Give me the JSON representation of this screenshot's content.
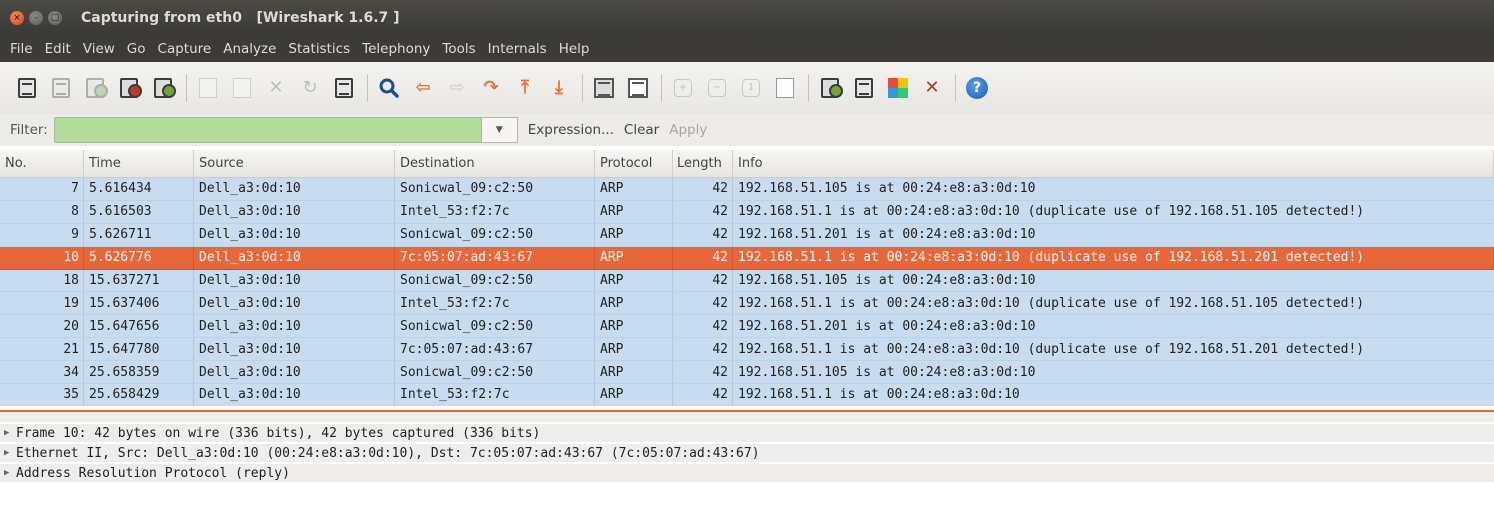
{
  "window": {
    "title": "Capturing from eth0   [Wireshark 1.6.7 ]",
    "close_glyph": "×",
    "min_glyph": "–",
    "max_glyph": "□"
  },
  "menu": [
    "File",
    "Edit",
    "View",
    "Go",
    "Capture",
    "Analyze",
    "Statistics",
    "Telephony",
    "Tools",
    "Internals",
    "Help"
  ],
  "toolbar": {
    "icons": [
      "interfaces-icon",
      "capture-options-icon",
      "start-capture-icon",
      "stop-capture-icon",
      "restart-capture-icon",
      "open-file-icon",
      "save-file-icon",
      "close-file-icon",
      "reload-icon",
      "print-icon",
      "find-packet-icon",
      "go-back-icon",
      "go-forward-icon",
      "go-to-packet-icon",
      "go-first-icon",
      "go-last-icon",
      "colorize-list-icon",
      "autoscroll-icon",
      "zoom-in-icon",
      "zoom-out-icon",
      "normal-size-icon",
      "resize-columns-icon",
      "capture-filters-icon",
      "display-filters-icon",
      "coloring-rules-icon",
      "preferences-icon",
      "help-icon"
    ]
  },
  "filter": {
    "label": "Filter:",
    "value": "",
    "expression": "Expression...",
    "clear": "Clear",
    "apply": "Apply"
  },
  "packet_list": {
    "columns": [
      "No.",
      "Time",
      "Source",
      "Destination",
      "Protocol",
      "Length",
      "Info"
    ],
    "selected_index": 3,
    "rows": [
      {
        "no": "7",
        "time": "5.616434",
        "src": "Dell_a3:0d:10",
        "dst": "Sonicwal_09:c2:50",
        "proto": "ARP",
        "len": "42",
        "info": "192.168.51.105 is at 00:24:e8:a3:0d:10"
      },
      {
        "no": "8",
        "time": "5.616503",
        "src": "Dell_a3:0d:10",
        "dst": "Intel_53:f2:7c",
        "proto": "ARP",
        "len": "42",
        "info": "192.168.51.1 is at 00:24:e8:a3:0d:10 (duplicate use of 192.168.51.105 detected!)"
      },
      {
        "no": "9",
        "time": "5.626711",
        "src": "Dell_a3:0d:10",
        "dst": "Sonicwal_09:c2:50",
        "proto": "ARP",
        "len": "42",
        "info": "192.168.51.201 is at 00:24:e8:a3:0d:10"
      },
      {
        "no": "10",
        "time": "5.626776",
        "src": "Dell_a3:0d:10",
        "dst": "7c:05:07:ad:43:67",
        "proto": "ARP",
        "len": "42",
        "info": "192.168.51.1 is at 00:24:e8:a3:0d:10 (duplicate use of 192.168.51.201 detected!)"
      },
      {
        "no": "18",
        "time": "15.637271",
        "src": "Dell_a3:0d:10",
        "dst": "Sonicwal_09:c2:50",
        "proto": "ARP",
        "len": "42",
        "info": "192.168.51.105 is at 00:24:e8:a3:0d:10"
      },
      {
        "no": "19",
        "time": "15.637406",
        "src": "Dell_a3:0d:10",
        "dst": "Intel_53:f2:7c",
        "proto": "ARP",
        "len": "42",
        "info": "192.168.51.1 is at 00:24:e8:a3:0d:10 (duplicate use of 192.168.51.105 detected!)"
      },
      {
        "no": "20",
        "time": "15.647656",
        "src": "Dell_a3:0d:10",
        "dst": "Sonicwal_09:c2:50",
        "proto": "ARP",
        "len": "42",
        "info": "192.168.51.201 is at 00:24:e8:a3:0d:10"
      },
      {
        "no": "21",
        "time": "15.647780",
        "src": "Dell_a3:0d:10",
        "dst": "7c:05:07:ad:43:67",
        "proto": "ARP",
        "len": "42",
        "info": "192.168.51.1 is at 00:24:e8:a3:0d:10 (duplicate use of 192.168.51.201 detected!)"
      },
      {
        "no": "34",
        "time": "25.658359",
        "src": "Dell_a3:0d:10",
        "dst": "Sonicwal_09:c2:50",
        "proto": "ARP",
        "len": "42",
        "info": "192.168.51.105 is at 00:24:e8:a3:0d:10"
      },
      {
        "no": "35",
        "time": "25.658429",
        "src": "Dell_a3:0d:10",
        "dst": "Intel_53:f2:7c",
        "proto": "ARP",
        "len": "42",
        "info": "192.168.51.1 is at 00:24:e8:a3:0d:10"
      }
    ]
  },
  "details": [
    "Frame 10: 42 bytes on wire (336 bits), 42 bytes captured (336 bits)",
    "Ethernet II, Src: Dell_a3:0d:10 (00:24:e8:a3:0d:10), Dst: 7c:05:07:ad:43:67 (7c:05:07:ad:43:67)",
    "Address Resolution Protocol (reply)"
  ],
  "colors": {
    "row_bg": "#c9dcef",
    "selected_bg": "#e8673a",
    "filter_bg": "#b3dc9c",
    "titlebar_bg": "#3c3b37"
  }
}
